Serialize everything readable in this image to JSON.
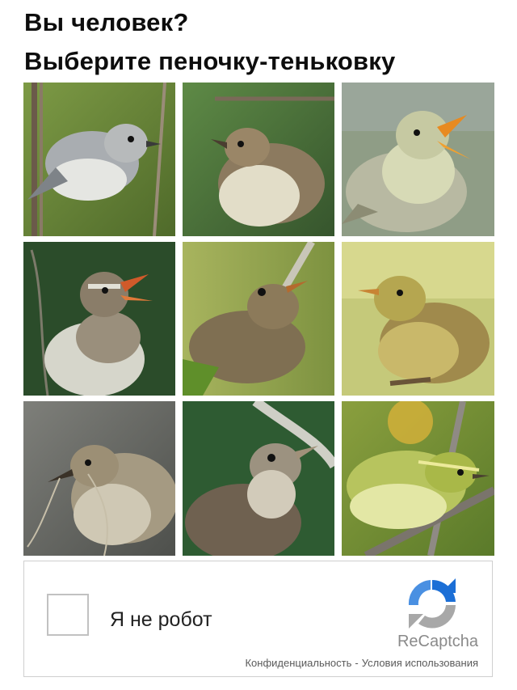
{
  "captcha": {
    "question": "Вы человек?",
    "instruction": "Выберите пеночку-теньковку",
    "tiles": [
      {
        "subject": "grey warbler on stem",
        "background": "#6f8b3c"
      },
      {
        "subject": "brown warbler",
        "background": "#4f7a3a"
      },
      {
        "subject": "singing pale warbler",
        "background": "#8c9b83"
      },
      {
        "subject": "singing warbler",
        "background": "#2e4f2c"
      },
      {
        "subject": "brown warbler on stem",
        "background": "#8fa24a"
      },
      {
        "subject": "yellowish warbler",
        "background": "#bdc26c"
      },
      {
        "subject": "warbler with nesting material",
        "background": "#6b6f6c"
      },
      {
        "subject": "warbler close-up",
        "background": "#2f5a33"
      },
      {
        "subject": "yellow-green warbler on branch",
        "background": "#6e8d3a"
      }
    ]
  },
  "recaptcha": {
    "checkbox_label": "Я не робот",
    "brand": "ReCaptcha",
    "privacy": "Конфиденциальность",
    "separator": "-",
    "terms": "Условия использования",
    "colors": {
      "blue": "#1c6fd6",
      "grey": "#a8a8a8",
      "border": "#cfcfcf"
    }
  }
}
